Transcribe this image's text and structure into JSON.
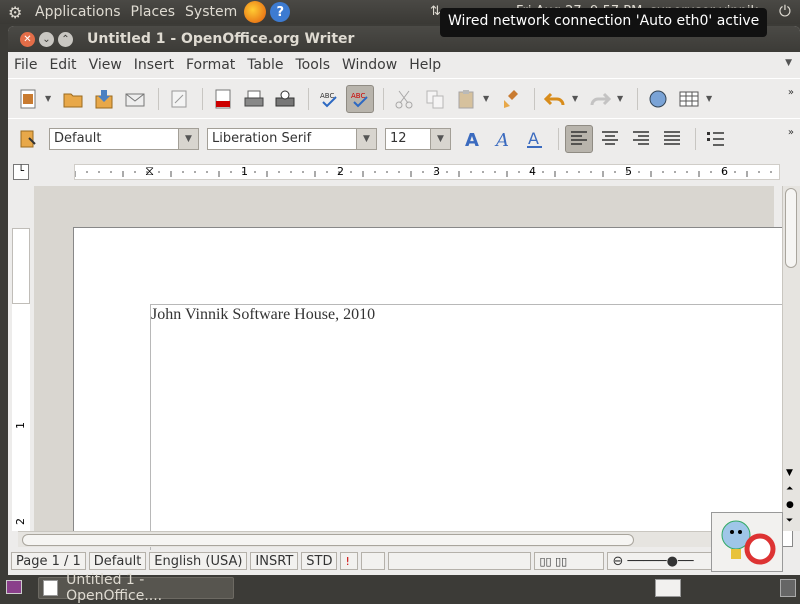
{
  "top_panel": {
    "applications": "Applications",
    "places": "Places",
    "system": "System",
    "clock": "Fri Aug 27, 9:57 PM",
    "user": "superuser vinnik"
  },
  "tooltip": "Wired network connection 'Auto eth0' active",
  "window": {
    "title": "Untitled 1 - OpenOffice.org Writer"
  },
  "menu": [
    "File",
    "Edit",
    "View",
    "Insert",
    "Format",
    "Table",
    "Tools",
    "Window",
    "Help"
  ],
  "format": {
    "style": "Default",
    "font": "Liberation Serif",
    "size": "12"
  },
  "ruler_labels": [
    "1",
    "2",
    "3",
    "4",
    "5",
    "6"
  ],
  "vruler_labels": [
    "1",
    "2"
  ],
  "document": {
    "text": "John Vinnik Software House, 2010"
  },
  "status": {
    "page": "Page 1 / 1",
    "style": "Default",
    "language": "English (USA)",
    "insert": "INSRT",
    "selection": "STD"
  },
  "taskbar": {
    "item": "Untitled 1 - OpenOffice...."
  },
  "colors": {
    "panel": "#3c3b37",
    "window_bg": "#edeceb",
    "close": "#e36d48"
  }
}
